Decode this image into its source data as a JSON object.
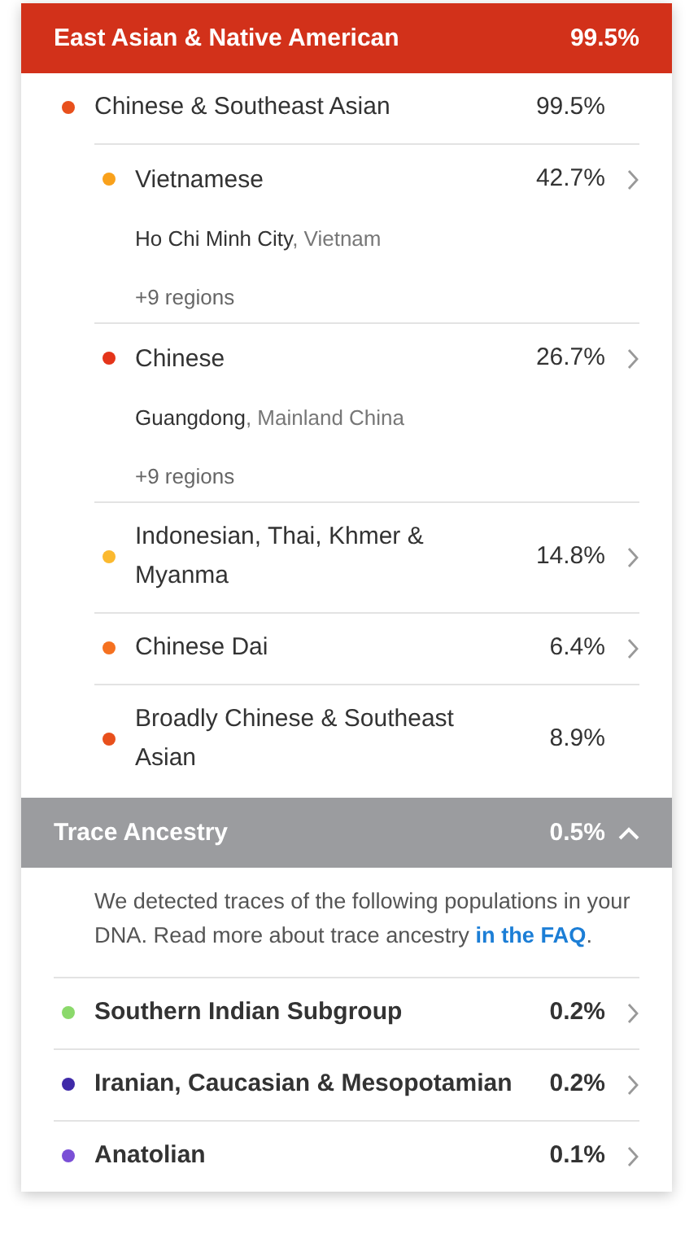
{
  "header": {
    "label": "East Asian & Native American",
    "percent": "99.5%"
  },
  "group": {
    "label": "Chinese & Southeast Asian",
    "percent": "99.5%",
    "color": "#e8501c",
    "expandable": false,
    "children": [
      {
        "label": "Vietnamese",
        "percent": "42.7%",
        "color": "#f9a11b",
        "expandable": true,
        "location": "**Ho Chi Minh City**, Vietnam",
        "regions": "+9 regions"
      },
      {
        "label": "Chinese",
        "percent": "26.7%",
        "color": "#e4341a",
        "expandable": true,
        "location": "**Guangdong**, Mainland China",
        "regions": "+9 regions"
      },
      {
        "label": "Indonesian, Thai, Khmer & Myanma",
        "percent": "14.8%",
        "color": "#fbb92f",
        "expandable": true
      },
      {
        "label": "Chinese Dai",
        "percent": "6.4%",
        "color": "#f57120",
        "expandable": true
      },
      {
        "label": "Broadly Chinese & Southeast Asian",
        "percent": "8.9%",
        "color": "#e8501c",
        "expandable": false
      }
    ]
  },
  "trace": {
    "label": "Trace Ancestry",
    "percent": "0.5%",
    "expanded": true,
    "note": {
      "text": "We detected traces of the following populations in your DNA. Read more about trace ancestry ",
      "link": "in the FAQ",
      "after": "."
    },
    "items": [
      {
        "label": "Southern Indian Subgroup",
        "percent": "0.2%",
        "color": "#8bd96b",
        "expandable": true
      },
      {
        "label": "Iranian, Caucasian & Mesopotamian",
        "percent": "0.2%",
        "color": "#3f2aa8",
        "expandable": true
      },
      {
        "label": "Anatolian",
        "percent": "0.1%",
        "color": "#7a4fd6",
        "expandable": true
      }
    ]
  }
}
